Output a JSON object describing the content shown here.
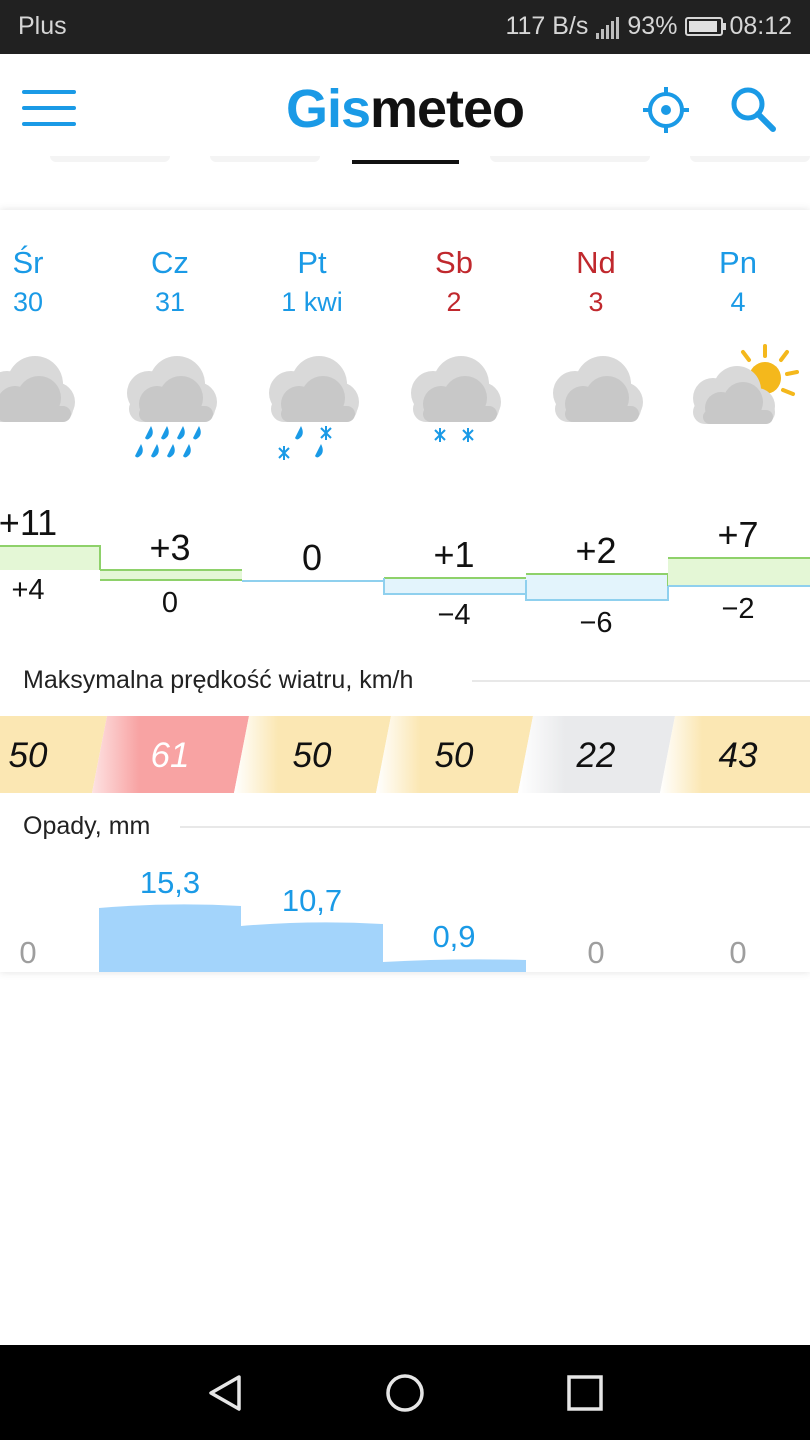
{
  "status_bar": {
    "carrier": "Plus",
    "net_speed": "117 B/s",
    "battery": "93%",
    "time": "08:12",
    "icons": [
      "signal-icon",
      "battery-icon"
    ]
  },
  "header": {
    "logo_part1": "Gis",
    "logo_part2": "meteo",
    "icons": [
      "menu-icon",
      "location-icon",
      "search-icon"
    ],
    "accent_color": "#1a9ae6"
  },
  "days": [
    {
      "name": "Śr",
      "date": "30",
      "weekend": false,
      "weather": "cloudy",
      "max": "+11",
      "min": "+4",
      "wind": "50",
      "precip": "0"
    },
    {
      "name": "Cz",
      "date": "31",
      "weekend": false,
      "weather": "cloudy-rain",
      "max": "+3",
      "min": "0",
      "wind": "61",
      "precip": "15,3"
    },
    {
      "name": "Pt",
      "date": "1 kwi",
      "weekend": false,
      "weather": "cloudy-rain-snow",
      "max": "0",
      "min": "",
      "wind": "50",
      "precip": "10,7"
    },
    {
      "name": "Sb",
      "date": "2",
      "weekend": true,
      "weather": "cloudy-snow",
      "max": "+1",
      "min": "−4",
      "wind": "50",
      "precip": "0,9"
    },
    {
      "name": "Nd",
      "date": "3",
      "weekend": true,
      "weather": "cloudy",
      "max": "+2",
      "min": "−6",
      "wind": "22",
      "precip": "0"
    },
    {
      "name": "Pn",
      "date": "4",
      "weekend": false,
      "weather": "partly-sunny",
      "max": "+7",
      "min": "−2",
      "wind": "43",
      "precip": "0"
    }
  ],
  "wind": {
    "title": "Maksymalna prędkość wiatru, km/h",
    "unit": "km/h"
  },
  "precipitation": {
    "title": "Opady, mm",
    "unit": "mm"
  },
  "colors": {
    "weekday": "#1a9ae6",
    "weekend": "#c0282d",
    "wind_moderate": "#fbe7b3",
    "wind_strong": "#f8a3a3",
    "wind_calm": "#e9eaec",
    "precip_fill": "#a3d4fb",
    "temp_warm_fill": "#e4f7d6",
    "temp_warm_line": "#8ed16a",
    "temp_cold_fill": "#e3f4fc",
    "temp_cold_line": "#8fd0ee"
  },
  "nav_bar": {
    "icons": [
      "back-icon",
      "home-icon",
      "recents-icon"
    ]
  }
}
